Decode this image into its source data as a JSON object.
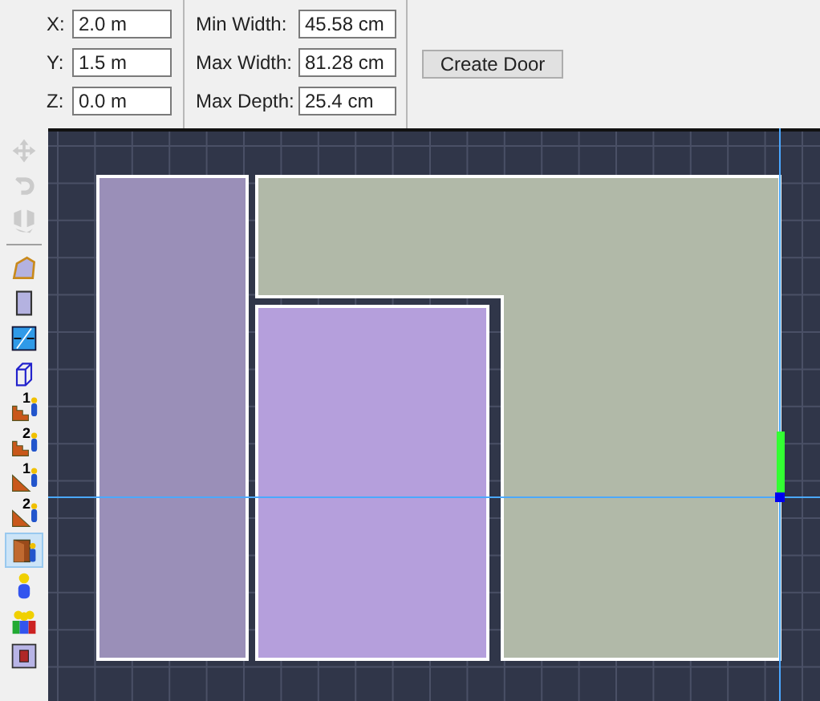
{
  "position_fields": [
    {
      "label": "X:",
      "value": "2.0 m"
    },
    {
      "label": "Y:",
      "value": "1.5 m"
    },
    {
      "label": "Z:",
      "value": "0.0 m"
    }
  ],
  "size_fields": [
    {
      "label": "Min Width:",
      "value": "45.58 cm"
    },
    {
      "label": "Max Width:",
      "value": "81.28 cm"
    },
    {
      "label": "Max Depth:",
      "value": "25.4 cm"
    }
  ],
  "create_button": "Create Door",
  "toolbar": [
    {
      "kind": "move",
      "disabled": true,
      "selected": false
    },
    {
      "kind": "rotate",
      "disabled": true,
      "selected": false
    },
    {
      "kind": "flip",
      "disabled": true,
      "selected": false
    },
    {
      "kind": "separator"
    },
    {
      "kind": "polygon",
      "disabled": false,
      "selected": false
    },
    {
      "kind": "rect",
      "disabled": false,
      "selected": false
    },
    {
      "kind": "split",
      "disabled": false,
      "selected": false
    },
    {
      "kind": "box",
      "disabled": false,
      "selected": false
    },
    {
      "kind": "stairs",
      "badge": "1",
      "disabled": false,
      "selected": false
    },
    {
      "kind": "stairs",
      "badge": "2",
      "disabled": false,
      "selected": false
    },
    {
      "kind": "ramp",
      "badge": "1",
      "disabled": false,
      "selected": false
    },
    {
      "kind": "ramp",
      "badge": "2",
      "disabled": false,
      "selected": false
    },
    {
      "kind": "door",
      "disabled": false,
      "selected": true
    },
    {
      "kind": "person",
      "disabled": false,
      "selected": false
    },
    {
      "kind": "group",
      "disabled": false,
      "selected": false
    },
    {
      "kind": "panel",
      "disabled": false,
      "selected": false
    }
  ],
  "rooms": [
    {
      "color": "#9a8fb8"
    },
    {
      "color": "#b1b9a8"
    },
    {
      "color": "#b59fdc"
    }
  ]
}
